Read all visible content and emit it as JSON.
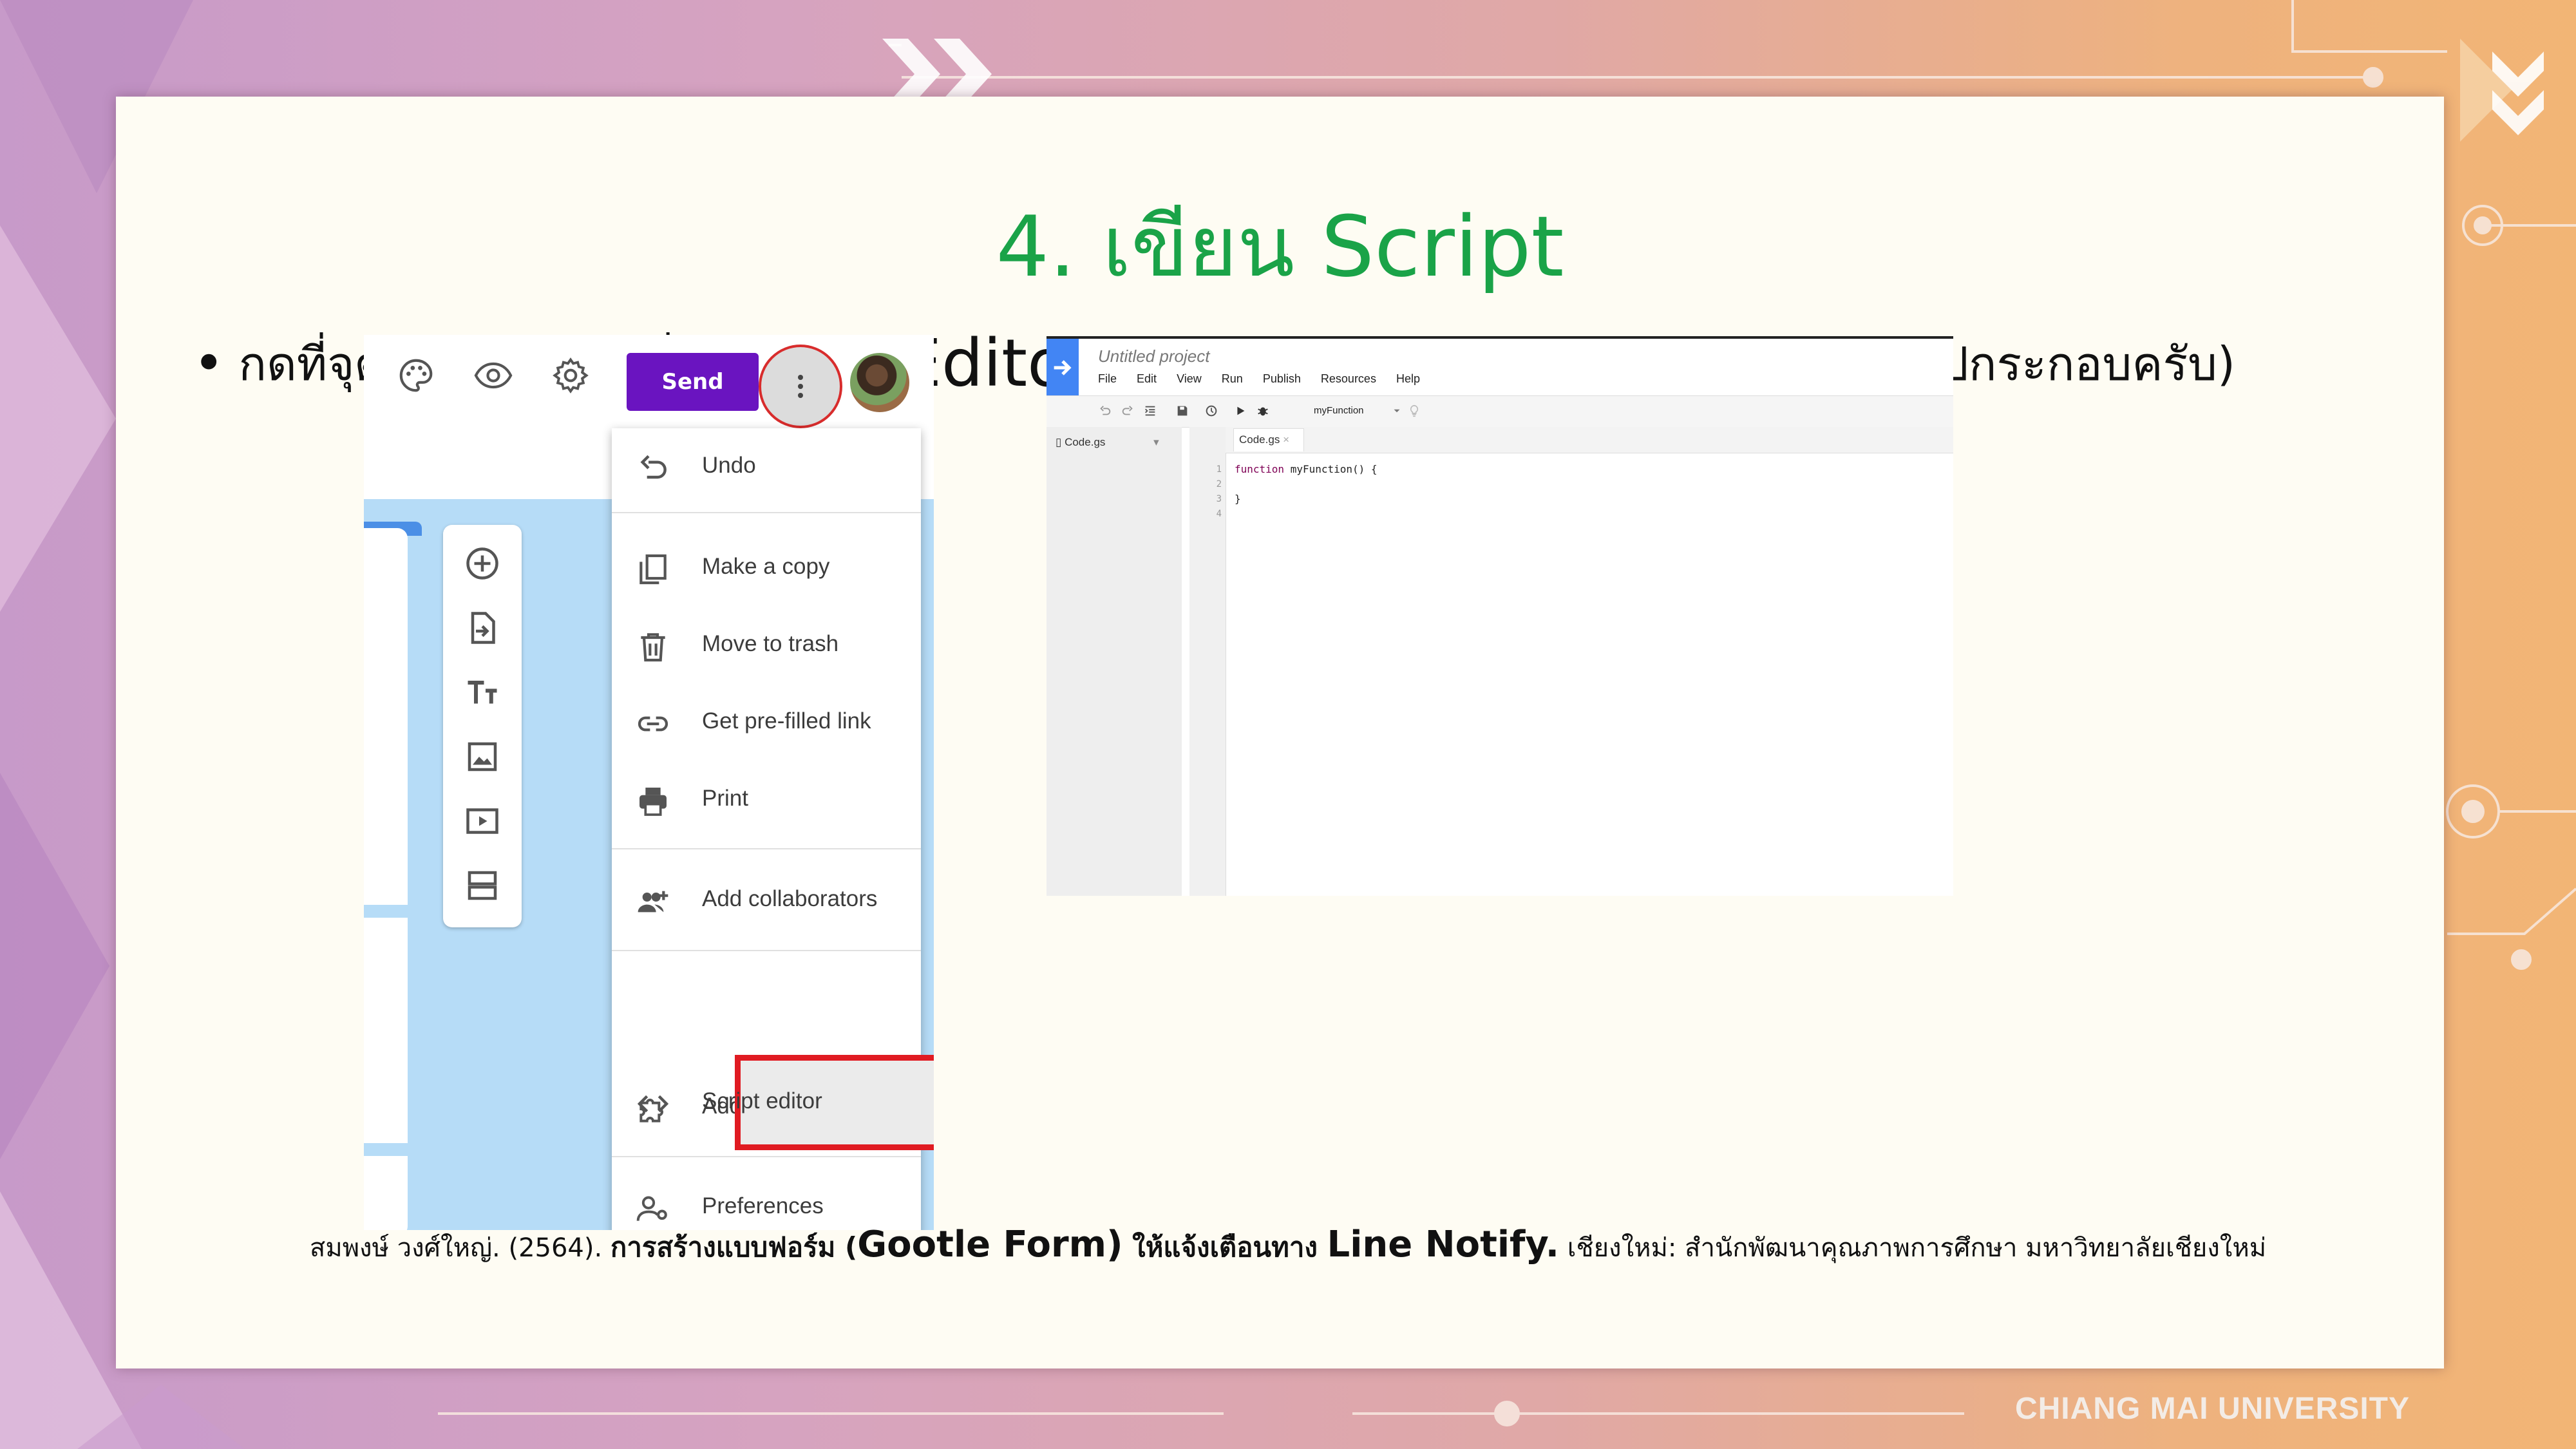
{
  "slide": {
    "title": "4. เขียน Script",
    "bullet": {
      "part1": "กดที่จุด 3 จุดแล้วกดที่ ",
      "part2": "Script Editor",
      "part3": " (ภาษาอาจไม่เหมือนกัน ถ้าไม่เหมือนให้ดูรูปกระกอบครับ)"
    }
  },
  "forms_screenshot": {
    "top_icons": [
      "palette-icon",
      "eye-icon",
      "gear-icon"
    ],
    "send_label": "Send",
    "more_icon": "more-vert-icon",
    "side_tools": [
      "add-circle-icon",
      "import-icon",
      "title-text-icon",
      "image-icon",
      "video-icon",
      "section-icon"
    ],
    "menu": [
      {
        "label": "Undo",
        "icon": "undo-icon"
      },
      {
        "label": "Make a copy",
        "icon": "copy-icon"
      },
      {
        "label": "Move to trash",
        "icon": "trash-icon"
      },
      {
        "label": "Get pre-filled link",
        "icon": "link-icon"
      },
      {
        "label": "Print",
        "icon": "print-icon"
      },
      {
        "label": "Add collaborators",
        "icon": "add-people-icon"
      },
      {
        "label": "Script editor",
        "icon": "code-icon"
      },
      {
        "label": "Add-ons",
        "icon": "puzzle-icon"
      },
      {
        "label": "Preferences",
        "icon": "preferences-icon"
      }
    ],
    "highlight_color": "#e01b22",
    "send_color": "#6a14c0"
  },
  "script_editor_screenshot": {
    "project_title": "Untitled project",
    "menu": [
      "File",
      "Edit",
      "View",
      "Run",
      "Publish",
      "Resources",
      "Help"
    ],
    "function_select": "myFunction",
    "sidebar_file": "Code.gs",
    "tab": "Code.gs",
    "line_numbers": [
      "1",
      "2",
      "3",
      "4"
    ],
    "code": {
      "line1_kw": "function",
      "line1_rest": " myFunction() {",
      "line3": "}"
    }
  },
  "citation": {
    "author": "สมพงษ์ วงศ์ใหญ่. (2564).  ",
    "title_a": "การสร้างแบบฟอร์ม (",
    "title_b": "Gootle Form)",
    "title_c": " ให้แจ้งเตือนทาง ",
    "title_d": "Line Notify.",
    "publisher": "  เชียงใหม่: สำนักพัฒนาคุณภาพการศึกษา มหาวิทยาลัยเชียงใหม่"
  },
  "footer": {
    "university": "CHIANG MAI UNIVERSITY"
  },
  "colors": {
    "title": "#1aa348",
    "slide_bg": "#fefcf3"
  }
}
